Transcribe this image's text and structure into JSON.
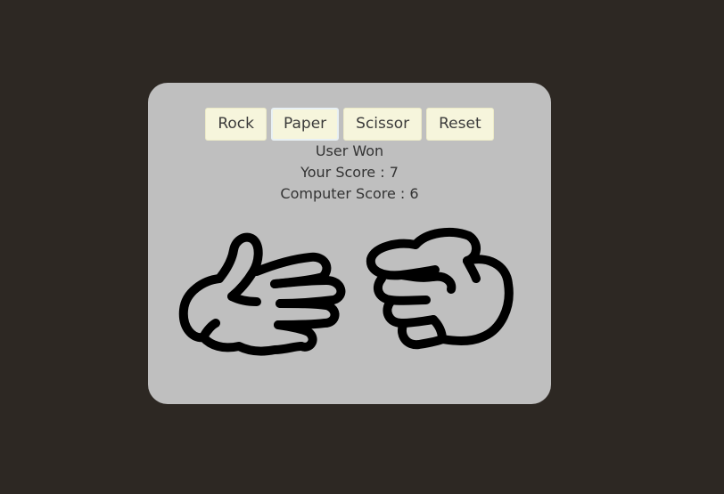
{
  "buttons": {
    "rock": "Rock",
    "paper": "Paper",
    "scissor": "Scissor",
    "reset": "Reset"
  },
  "status": {
    "result": "User Won",
    "your_score": "Your Score : 7",
    "computer_score": "Computer Score : 6"
  },
  "choices": {
    "user_choice_icon": "paper-hand-icon",
    "computer_choice_icon": "rock-fist-icon"
  },
  "colors": {
    "page_background": "#2d2823",
    "card_background": "#bfbfbf",
    "button_background": "#f6f5dc",
    "text": "#333333"
  }
}
